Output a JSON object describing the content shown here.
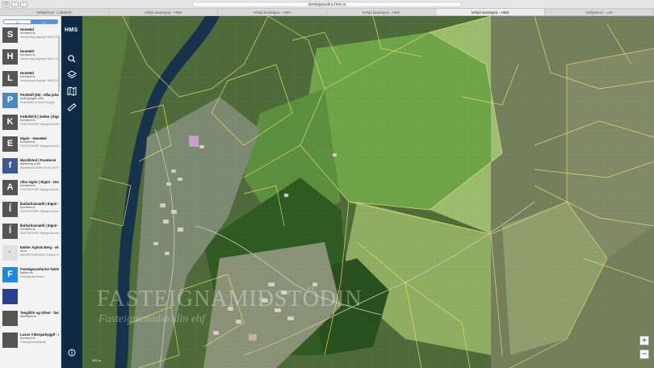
{
  "browser": {
    "url": "landeignaskra.hms.is",
    "tabs": [
      "Vefsjá/Kort - L3M4ND",
      "Vefsjá landeigna - HMS",
      "Vefsjá landeigna - HMS",
      "Vefsjá landeigna - HMS",
      "Vefsjá landeigna - HMS",
      "Vefsjá/Kort - Leit"
    ],
    "active_tab": 4
  },
  "sidebar": {
    "segments": [
      "",
      ""
    ],
    "items": [
      {
        "letter": "S",
        "color": "#555555",
        "title": "HomeEd",
        "site": "homeed.is",
        "desc": "Ventar þig aðgang? BÚA TIL AÐGANG HomeEd..."
      },
      {
        "letter": "H",
        "color": "#555555",
        "title": "HomeEd",
        "site": "homeed.is",
        "desc": "Ventar þig aðgang? BÚA TIL AÐGANG HomeEd..."
      },
      {
        "letter": "L",
        "color": "#555555",
        "title": "HomeEd",
        "site": "homeed.is",
        "desc": "Ventar þig aðgang? BÚA TIL AÐGANG HomeEd..."
      },
      {
        "letter": "P",
        "color": "#4a86c8",
        "title": "Pósthólf (26) - elfar.johannsson@g...",
        "site": "mail.google.com",
        "desc": "Pósthólfið al Netfi Google"
      },
      {
        "letter": "K",
        "color": "#555555",
        "title": "Kötlufell 8 | Seldar | Eignir - HomeEd",
        "site": "homeed.is",
        "desc": "FASTEIGNIR: Nýlega skoðað IS Öfer Frept J..."
      },
      {
        "letter": "E",
        "color": "#555555",
        "title": "Eignir - HomeEd",
        "site": "homeed.is",
        "desc": "FASTEIGNIR: Nýlega skoðað IS Öfer Frept J..."
      },
      {
        "letter": "f",
        "color": "#3b5998",
        "title": "Myndbönd | Facebook",
        "site": "facebook.com",
        "desc": "Myndbönd Marra Horn Vik Reels Shows Skoð..."
      },
      {
        "letter": "A",
        "color": "#555555",
        "title": "Allar eignir | Eignir - HomeEd",
        "site": "homeed.is",
        "desc": "FASTEIGNIR: Nýlega skoðað IS Öfer Frept J..."
      },
      {
        "letter": "Í",
        "color": "#555555",
        "title": "Íbúðarhúsnæði | Eignir - HomeEd",
        "site": "homeed.is",
        "desc": "FASTEIGNIR: Nýlega skoðað IS Öfer Frept J..."
      },
      {
        "letter": "Í",
        "color": "#555555",
        "title": "Íbúðarhúsnæði | Eignir - HomeEd",
        "site": "homeed.is",
        "desc": "FASTEIGNIR: Nýlega skoðað IS Öfer Frept J..."
      },
      {
        "letter": "·",
        "color": "#e0e0e0",
        "title": "Esther Ágústa Berg - ok.is",
        "site": "ok.is",
        "desc": "ADVERTISEMENT Esther Ágústa Berg Se..."
      },
      {
        "letter": "F",
        "color": "#1e88e5",
        "title": "Fasteignavefurinn fastinn",
        "site": "fastinn.is",
        "desc": "Fasteignavefurinn"
      },
      {
        "letter": "",
        "color": "#2a3f8f",
        "title": "",
        "site": "",
        "desc": ""
      },
      {
        "letter": "",
        "color": "#555555",
        "title": "Tengiliðir og Aðser - fasteignir.is",
        "site": "fasteignir.is",
        "desc": ""
      },
      {
        "letter": "",
        "color": "#555555",
        "title": "Luxus 3 Borgarbyggð - Aðser Kjartansdótt...",
        "site": "homeed.is",
        "desc": "Fasteignaheildsala"
      }
    ]
  },
  "mapnav": {
    "logo": "HMS",
    "buttons": [
      "search-icon",
      "layers-icon",
      "map-icon",
      "ruler-icon"
    ],
    "info": "info-icon"
  },
  "map": {
    "zoom_in": "+",
    "zoom_out": "−",
    "scale": "200 m"
  },
  "watermark": {
    "line1": "FASTEIGNAMIÐSTÖÐIN",
    "line2": "Fasteignamidstodin ehf"
  }
}
